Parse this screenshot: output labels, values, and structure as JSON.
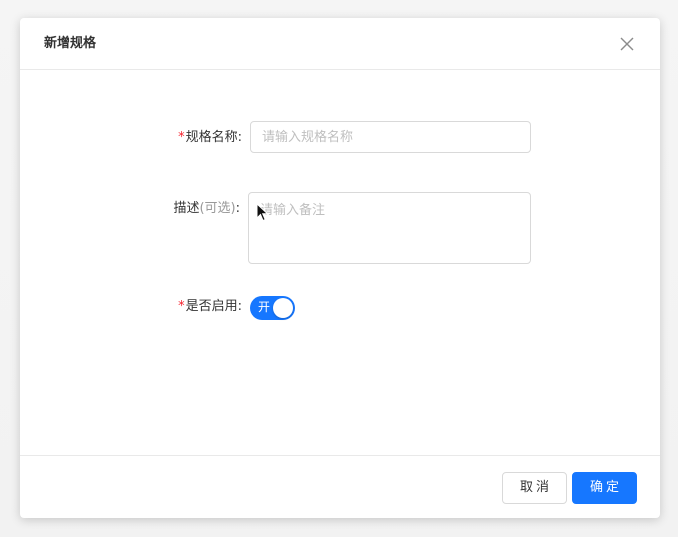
{
  "dialog": {
    "title": "新增规格"
  },
  "form": {
    "name": {
      "required_mark": "*",
      "label": "规格名称:",
      "placeholder": "请输入规格名称",
      "value": ""
    },
    "description": {
      "label": "描述",
      "optional_hint": "(可选)",
      "colon": ":",
      "placeholder": "请输入备注",
      "value": ""
    },
    "enabled": {
      "required_mark": "*",
      "label": "是否启用:",
      "switch_text": "开",
      "checked": true
    }
  },
  "footer": {
    "cancel_label": "取消",
    "ok_label": "确定"
  },
  "icons": {
    "close": "close-icon",
    "cursor": "mouse-pointer-icon"
  },
  "colors": {
    "primary": "#1677ff",
    "required": "#f5222d"
  }
}
